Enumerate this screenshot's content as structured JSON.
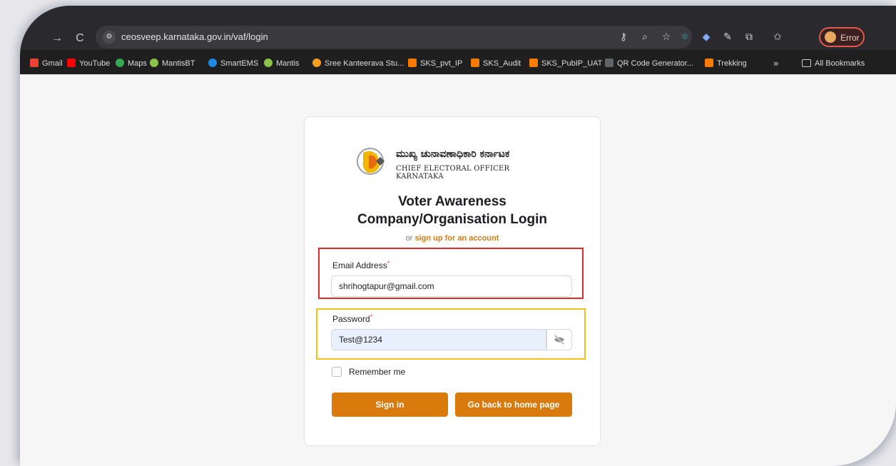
{
  "browser": {
    "url": "ceosveep.karnataka.gov.in/vaf/login",
    "error_chip": "Error",
    "bookmarks": [
      {
        "label": "Gmail",
        "color": "#ea4335"
      },
      {
        "label": "YouTube",
        "color": "#ff0000"
      },
      {
        "label": "Maps",
        "color": "#34a853"
      },
      {
        "label": "MantisBT",
        "color": "#8bc34a"
      },
      {
        "label": "SmartEMS",
        "color": "#1e88e5"
      },
      {
        "label": "Mantis",
        "color": "#8bc34a"
      },
      {
        "label": "Sree Kanteerava Stu...",
        "color": "#f4a020"
      },
      {
        "label": "SKS_pvt_IP",
        "color": "#f57c00"
      },
      {
        "label": "SKS_Audit",
        "color": "#f57c00"
      },
      {
        "label": "SKS_PubIP_UAT",
        "color": "#f57c00"
      },
      {
        "label": "QR Code Generator...",
        "color": "#5f6368"
      },
      {
        "label": "Trekking",
        "color": "#f57c00"
      }
    ],
    "more_bookmarks": "»",
    "all_bookmarks": "All Bookmarks"
  },
  "logo": {
    "kannada": "ಮುಖ್ಯ ಚುನಾವಣಾಧಿಕಾರಿ ಕರ್ನಾಟಕ",
    "english": "CHIEF ELECTORAL OFFICER KARNATAKA"
  },
  "login": {
    "title_line1": "Voter Awareness",
    "title_line2": "Company/Organisation Login",
    "or_text": "or",
    "signup_link": "sign up for an account",
    "email_label": "Email Address",
    "email_value": "shrihogtapur@gmail.com",
    "password_label": "Password",
    "password_value": "Test@1234",
    "required_mark": "*",
    "remember_label": "Remember me",
    "signin_button": "Sign in",
    "home_button": "Go back to home page"
  },
  "colors": {
    "accent": "#d97a0c",
    "highlight_red": "#e02b2b",
    "highlight_yellow": "#f2c21a"
  }
}
